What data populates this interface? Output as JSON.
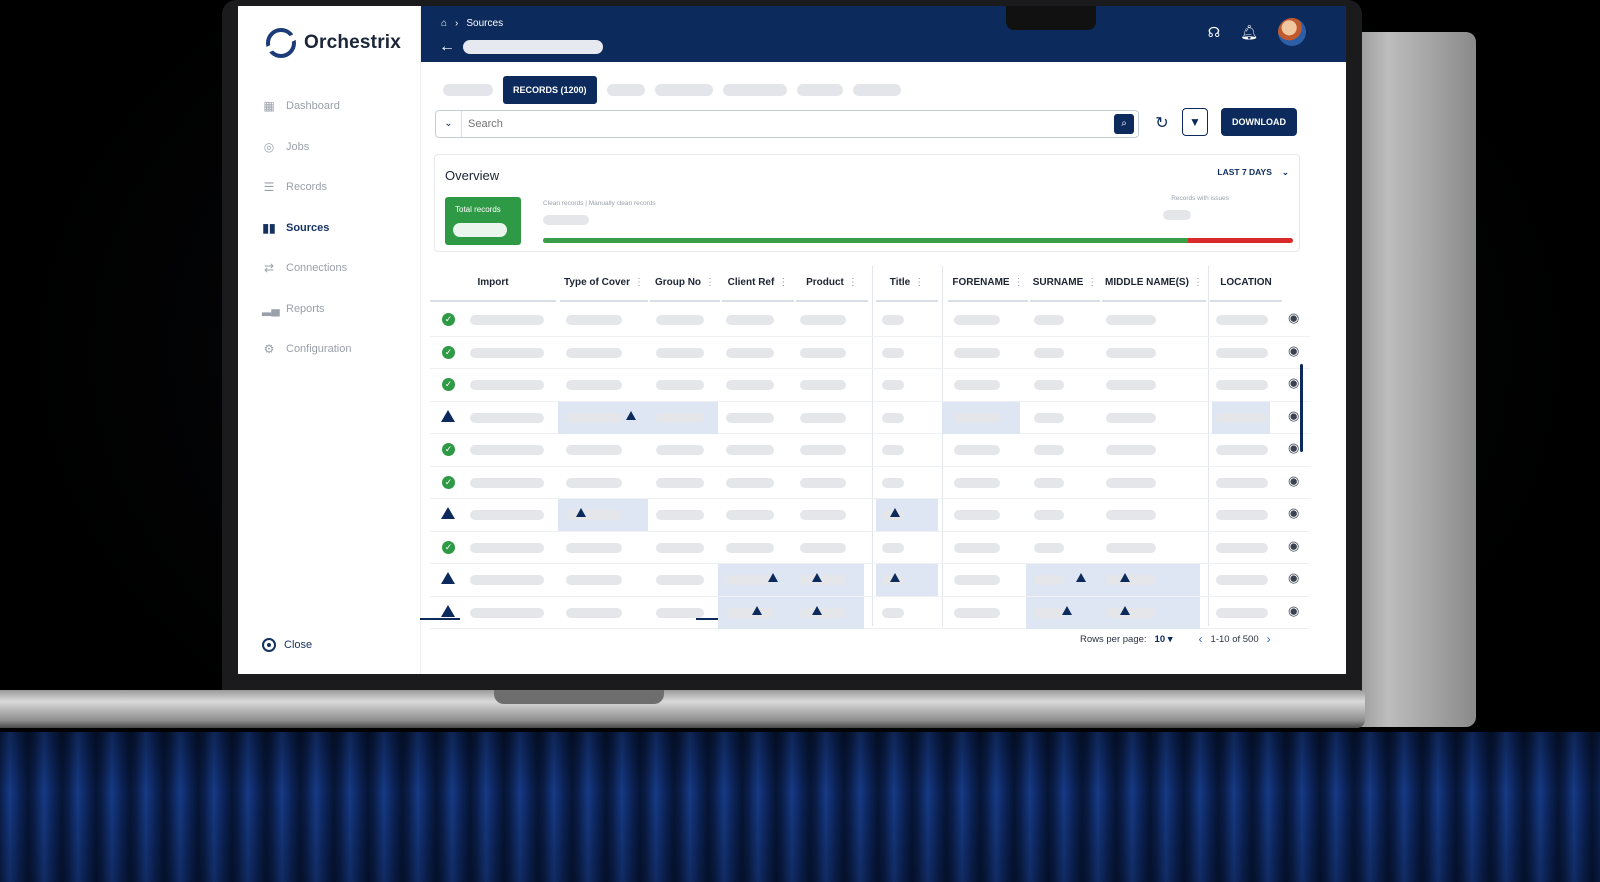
{
  "app": {
    "name": "Orchestrix"
  },
  "sidebar": {
    "items": [
      {
        "label": "Dashboard",
        "icon": "grid-icon"
      },
      {
        "label": "Jobs",
        "icon": "check-circle-icon"
      },
      {
        "label": "Records",
        "icon": "list-icon"
      },
      {
        "label": "Sources",
        "icon": "sources-icon",
        "active": true
      },
      {
        "label": "Connections",
        "icon": "connections-icon"
      },
      {
        "label": "Reports",
        "icon": "bar-chart-icon"
      },
      {
        "label": "Configuration",
        "icon": "gear-icon"
      }
    ],
    "close_label": "Close"
  },
  "header": {
    "breadcrumb": "Sources"
  },
  "tabs": {
    "active_label": "RECORDS (1200)"
  },
  "search": {
    "placeholder": "Search"
  },
  "toolbar": {
    "download_label": "DOWNLOAD"
  },
  "overview": {
    "title": "Overview",
    "range_label": "LAST 7 DAYS",
    "total_label": "Total records",
    "clean_label": "Clean records | Manually clean records",
    "issues_label": "Records with issues",
    "clean_fraction": 0.86
  },
  "table": {
    "columns": [
      "Import",
      "Type of Cover",
      "Group No",
      "Client Ref",
      "Product",
      "Title",
      "FORENAME",
      "SURNAME",
      "MIDDLE NAME(S)",
      "LOCATION"
    ],
    "row_status": [
      "ok",
      "ok",
      "ok",
      "warn",
      "ok",
      "ok",
      "warn",
      "ok",
      "warn",
      "warn"
    ]
  },
  "pagination": {
    "rows_label": "Rows per page:",
    "rows_value": "10",
    "range": "1-10 of 500"
  },
  "colors": {
    "brand": "#0c2b5c",
    "ok": "#2f9a45",
    "issue": "#d82a2a"
  }
}
